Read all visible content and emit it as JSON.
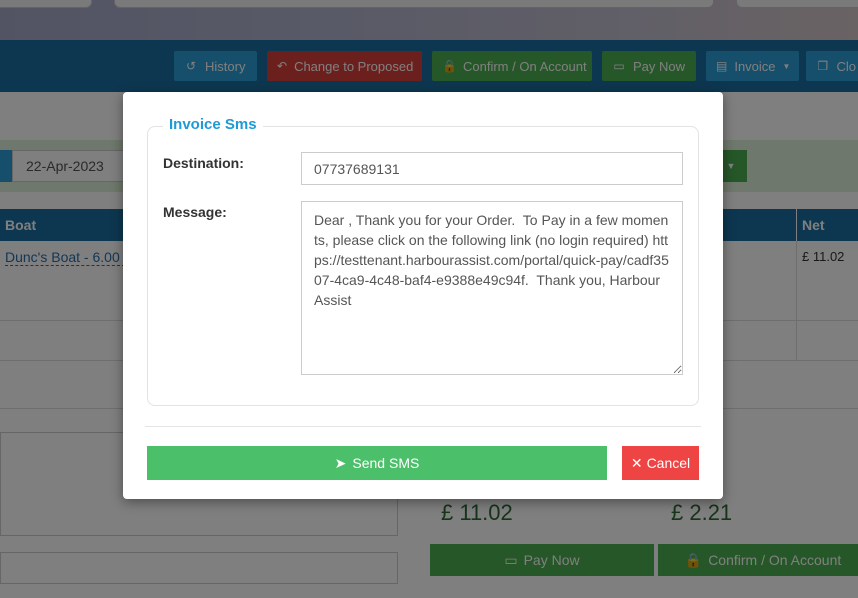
{
  "toolbar": {
    "history": "History",
    "change_to_proposed": "Change to Proposed",
    "confirm_on_account": "Confirm / On Account",
    "pay_now": "Pay Now",
    "invoice": "Invoice",
    "close": "Clo"
  },
  "filters": {
    "date": "22-Apr-2023"
  },
  "table": {
    "columns": {
      "boat": "Boat",
      "net": "Net"
    },
    "rows": [
      {
        "boat": "Dunc's Boat - 6.00 (",
        "net": "£ 11.02"
      }
    ]
  },
  "totals": {
    "total": "£ 11.02",
    "vat": "£ 2.21"
  },
  "footer_buttons": {
    "pay_now": "Pay Now",
    "confirm_on_account": "Confirm / On Account"
  },
  "modal": {
    "legend": "Invoice Sms",
    "destination_label": "Destination:",
    "destination_value": "07737689131",
    "message_label": "Message:",
    "message_value": "Dear , Thank you for your Order.  To Pay in a few moments, please click on the following link (no login required) https://testtenant.harbourassist.com/portal/quick-pay/cadf3507-4ca9-4c48-baf4-e9388e49c94f.  Thank you, Harbour Assist",
    "send_label": "Send SMS",
    "cancel_label": "Cancel"
  },
  "colors": {
    "primary": "#1a6fa1",
    "info": "#2a9fd6",
    "success": "#4caf50",
    "danger": "#ef4444",
    "legend": "#1e9ad6"
  },
  "icons": [
    "history-icon",
    "undo-icon",
    "lock-icon",
    "money-icon",
    "file-icon",
    "copy-icon",
    "paper-plane-icon",
    "close-icon",
    "caret-down-icon"
  ]
}
